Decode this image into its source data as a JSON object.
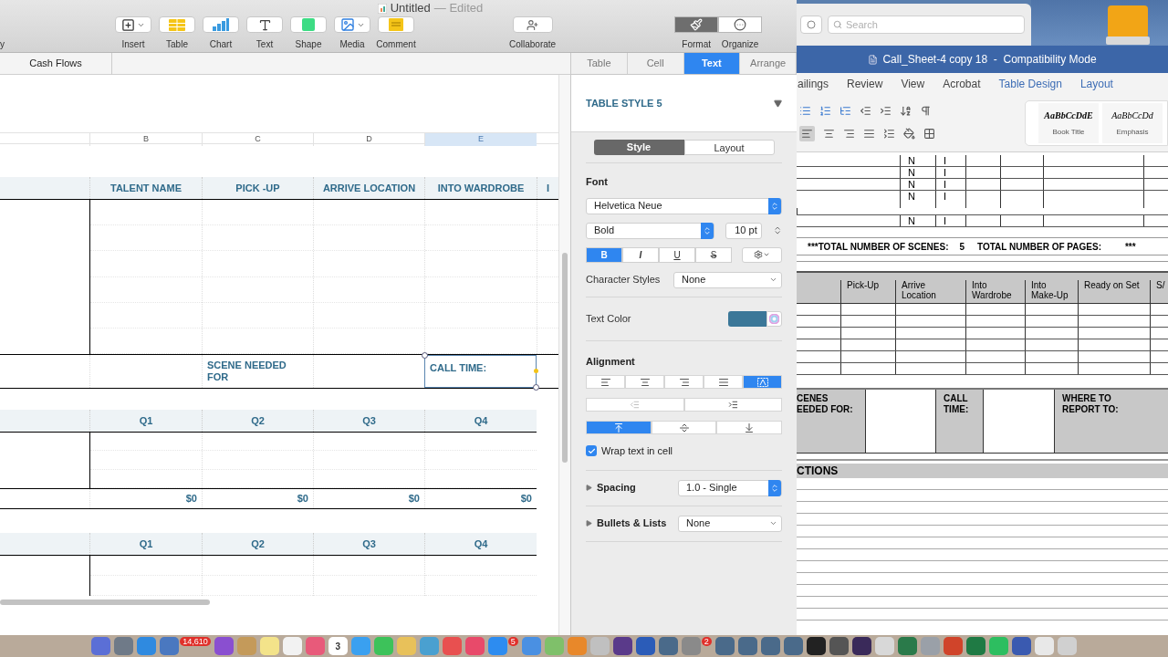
{
  "numbers": {
    "title": "Untitled",
    "title_status": "— Edited",
    "toolbar_cut_label": "y",
    "toolbar": [
      {
        "label": "Insert",
        "kind": "insert",
        "menu": true
      },
      {
        "label": "Table",
        "kind": "table",
        "menu": false
      },
      {
        "label": "Chart",
        "kind": "chart",
        "menu": false
      },
      {
        "label": "Text",
        "kind": "text",
        "menu": false
      },
      {
        "label": "Shape",
        "kind": "shape",
        "menu": false
      },
      {
        "label": "Media",
        "kind": "media",
        "menu": true
      },
      {
        "label": "Comment",
        "kind": "comment",
        "menu": false
      }
    ],
    "collaborate": "Collaborate",
    "view_buttons": [
      {
        "label": "Format",
        "kind": "format",
        "selected": true
      },
      {
        "label": "Organize",
        "kind": "organize",
        "selected": false
      }
    ],
    "sheet_tab": "Cash Flows",
    "column_headers": [
      {
        "label": "B",
        "selected": false
      },
      {
        "label": "C",
        "selected": false
      },
      {
        "label": "D",
        "selected": false
      },
      {
        "label": "E",
        "selected": true
      }
    ],
    "table1": {
      "columns": [
        "TALENT NAME",
        "PICK -UP",
        "ARRIVE LOCATION",
        "INTO WARDROBE",
        "I"
      ],
      "scene_label": "SCENE NEEDED FOR",
      "call_time": {
        "text": "CALL TIME:",
        "selected": true
      }
    },
    "table2": {
      "columns": [
        "Q1",
        "Q2",
        "Q3",
        "Q4"
      ],
      "totals": [
        "$0",
        "$0",
        "$0",
        "$0"
      ]
    },
    "table3": {
      "columns": [
        "Q1",
        "Q2",
        "Q3",
        "Q4"
      ]
    }
  },
  "inspector": {
    "tabs": [
      {
        "label": "Table",
        "selected": false
      },
      {
        "label": "Cell",
        "selected": false
      },
      {
        "label": "Text",
        "selected": true
      },
      {
        "label": "Arrange",
        "selected": false
      }
    ],
    "table_style": "TABLE STYLE 5",
    "segments": [
      {
        "label": "Style",
        "selected": true
      },
      {
        "label": "Layout",
        "selected": false
      }
    ],
    "font_label": "Font",
    "font": "Helvetica Neue",
    "typeface": "Bold",
    "size": "10 pt",
    "format_buttons": [
      {
        "kind": "bold",
        "label": "B",
        "on": true
      },
      {
        "kind": "italic",
        "label": "I",
        "on": false
      },
      {
        "kind": "underline",
        "label": "U",
        "on": false
      },
      {
        "kind": "strike",
        "label": "S",
        "on": false
      }
    ],
    "character_styles": {
      "label": "Character Styles",
      "value": "None"
    },
    "text_color": {
      "label": "Text Color",
      "color": "#3b7798"
    },
    "alignment_label": "Alignment",
    "horizontal": [
      {
        "kind": "left",
        "selected": false
      },
      {
        "kind": "center",
        "selected": false
      },
      {
        "kind": "right",
        "selected": false
      },
      {
        "kind": "justify",
        "selected": false
      },
      {
        "kind": "auto",
        "selected": true
      }
    ],
    "vertical": [
      {
        "kind": "top",
        "selected": true
      },
      {
        "kind": "middle",
        "selected": false
      },
      {
        "kind": "bottom",
        "selected": false
      }
    ],
    "wrap": {
      "label": "Wrap text in cell",
      "checked": true
    },
    "spacing": {
      "label": "Spacing",
      "value": "1.0 - Single"
    },
    "bullets": {
      "label": "Bullets & Lists",
      "value": "None"
    }
  },
  "word": {
    "search_placeholder": "Search",
    "title": "Call_Sheet-4 copy 18  -  Compatibility Mode",
    "ribbon_tabs": [
      {
        "label": "ailings",
        "contextual": false
      },
      {
        "label": "Review",
        "contextual": false
      },
      {
        "label": "View",
        "contextual": false
      },
      {
        "label": "Acrobat",
        "contextual": false
      },
      {
        "label": "Table Design",
        "contextual": true
      },
      {
        "label": "Layout",
        "contextual": true
      }
    ],
    "styles": [
      {
        "sample": "AaBbCcDdE",
        "name": "Book Title"
      },
      {
        "sample": "AaBbCcDd",
        "name": "Emphasis"
      }
    ],
    "scene_rows": [
      [
        "N",
        "I"
      ],
      [
        "N",
        "I"
      ],
      [
        "N",
        "I"
      ],
      [
        "N",
        "I"
      ],
      [
        "N",
        "I"
      ]
    ],
    "totals": [
      "***TOTAL NUMBER OF SCENES:",
      "5",
      "TOTAL NUMBER OF PAGES:",
      "***"
    ],
    "schedule_columns": [
      "Pick-Up",
      "Arrive Location",
      "Into Wardrobe",
      "Into Make-Up",
      "Ready on Set",
      "S/"
    ],
    "info_labels": [
      "CENES\nEEDED FOR:",
      "CALL\nTIME:",
      "WHERE TO\nREPORT TO:"
    ],
    "section": "CTIONS"
  },
  "dock": [
    {
      "color": "#5b6fd6"
    },
    {
      "color": "#6f7a88"
    },
    {
      "color": "#2f8ae0"
    },
    {
      "color": "#4a78c0",
      "badge": "14,610"
    },
    {
      "color": "#8a4fd0"
    },
    {
      "color": "#c49a5a"
    },
    {
      "color": "#f3e38a"
    },
    {
      "color": "#f2f2f2"
    },
    {
      "color": "#e85a7a"
    },
    {
      "color": "#ffffff",
      "label": "3"
    },
    {
      "color": "#3aa0f0"
    },
    {
      "color": "#3dc25a"
    },
    {
      "color": "#e8c15a"
    },
    {
      "color": "#4aa0d0"
    },
    {
      "color": "#e85050"
    },
    {
      "color": "#e84a6a"
    },
    {
      "color": "#2d8cf0",
      "badge": "5"
    },
    {
      "color": "#4a90e2"
    },
    {
      "color": "#7fc06a"
    },
    {
      "color": "#e8882a"
    },
    {
      "color": "#c0c0c0"
    },
    {
      "color": "#5a3a8a"
    },
    {
      "color": "#2b5cb8"
    },
    {
      "color": "#4a6a8a"
    },
    {
      "color": "#8a8a8a",
      "badge": "2"
    },
    {
      "color": "#4a6a8a"
    },
    {
      "color": "#4a6a8a"
    },
    {
      "color": "#4a6a8a"
    },
    {
      "color": "#4a6a8a"
    },
    {
      "color": "#222222"
    },
    {
      "color": "#555555"
    },
    {
      "color": "#3a2a5a"
    },
    {
      "color": "#d8d8d8"
    },
    {
      "color": "#2a7a4a"
    },
    {
      "color": "#9aa0a8"
    },
    {
      "color": "#d0442a"
    },
    {
      "color": "#1f7a44"
    },
    {
      "color": "#2dbe60"
    },
    {
      "color": "#3a5ab0"
    },
    {
      "color": "#e8e8e8"
    },
    {
      "color": "#d0d0d0"
    }
  ]
}
